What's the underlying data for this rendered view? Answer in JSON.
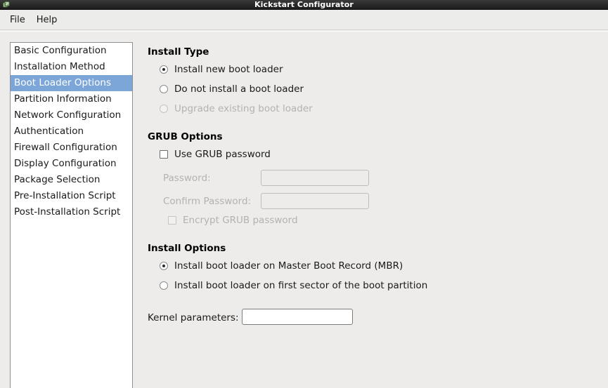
{
  "window": {
    "title": "Kickstart Configurator",
    "icon": "kickstart-app-icon"
  },
  "menubar": {
    "items": [
      {
        "label": "File"
      },
      {
        "label": "Help"
      }
    ]
  },
  "sidebar": {
    "items": [
      {
        "label": "Basic Configuration",
        "selected": false
      },
      {
        "label": "Installation Method",
        "selected": false
      },
      {
        "label": "Boot Loader Options",
        "selected": true
      },
      {
        "label": "Partition Information",
        "selected": false
      },
      {
        "label": "Network Configuration",
        "selected": false
      },
      {
        "label": "Authentication",
        "selected": false
      },
      {
        "label": "Firewall Configuration",
        "selected": false
      },
      {
        "label": "Display Configuration",
        "selected": false
      },
      {
        "label": "Package Selection",
        "selected": false
      },
      {
        "label": "Pre-Installation Script",
        "selected": false
      },
      {
        "label": "Post-Installation Script",
        "selected": false
      }
    ]
  },
  "install_type": {
    "title": "Install Type",
    "options": [
      {
        "label": "Install new boot loader",
        "checked": true,
        "disabled": false
      },
      {
        "label": "Do not install a boot loader",
        "checked": false,
        "disabled": false
      },
      {
        "label": "Upgrade existing boot loader",
        "checked": false,
        "disabled": true
      }
    ]
  },
  "grub_options": {
    "title": "GRUB Options",
    "use_password": {
      "label": "Use GRUB password",
      "checked": false,
      "disabled": false
    },
    "password": {
      "label": "Password:",
      "value": "",
      "disabled": true
    },
    "confirm_password": {
      "label": "Confirm Password:",
      "value": "",
      "disabled": true
    },
    "encrypt": {
      "label": "Encrypt GRUB password",
      "checked": false,
      "disabled": true
    }
  },
  "install_options": {
    "title": "Install Options",
    "options": [
      {
        "label": "Install boot loader on Master Boot Record (MBR)",
        "checked": true,
        "disabled": false
      },
      {
        "label": "Install boot loader on first sector of the boot partition",
        "checked": false,
        "disabled": false
      }
    ],
    "kernel_parameters": {
      "label": "Kernel parameters:",
      "value": "",
      "disabled": false
    }
  },
  "colors": {
    "selection": "#7ca6d8",
    "background": "#edecea",
    "titlebar": "#2c2c2c",
    "disabled_text": "#b4b2af"
  }
}
